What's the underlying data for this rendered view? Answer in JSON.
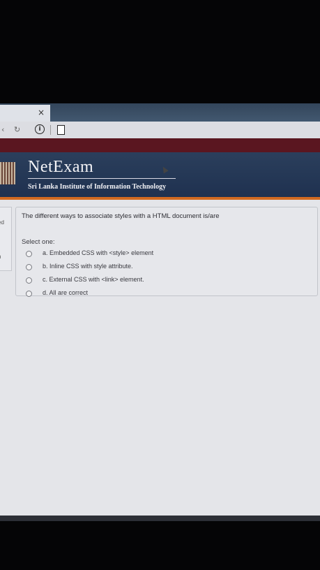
{
  "browser": {
    "tab_close": "×",
    "info_icon": "i",
    "page_icon": "▣"
  },
  "header": {
    "brand": "NetExam",
    "subtitle": "Sri Lanka Institute of Information Technology"
  },
  "side_info": {
    "line1": "ed",
    "line2": "n"
  },
  "question": {
    "text": "The different ways to associate styles with a HTML document is/are",
    "select_label": "Select one:",
    "options": [
      {
        "label": "a. Embedded CSS with <style> element"
      },
      {
        "label": "b. Inline CSS with style attribute."
      },
      {
        "label": "c. External CSS with <link> element."
      },
      {
        "label": "d. All are correct"
      }
    ]
  },
  "colors": {
    "banner": "#1f3150",
    "accent_stripe": "#d26a21",
    "maroon_bar": "#5a1620"
  }
}
